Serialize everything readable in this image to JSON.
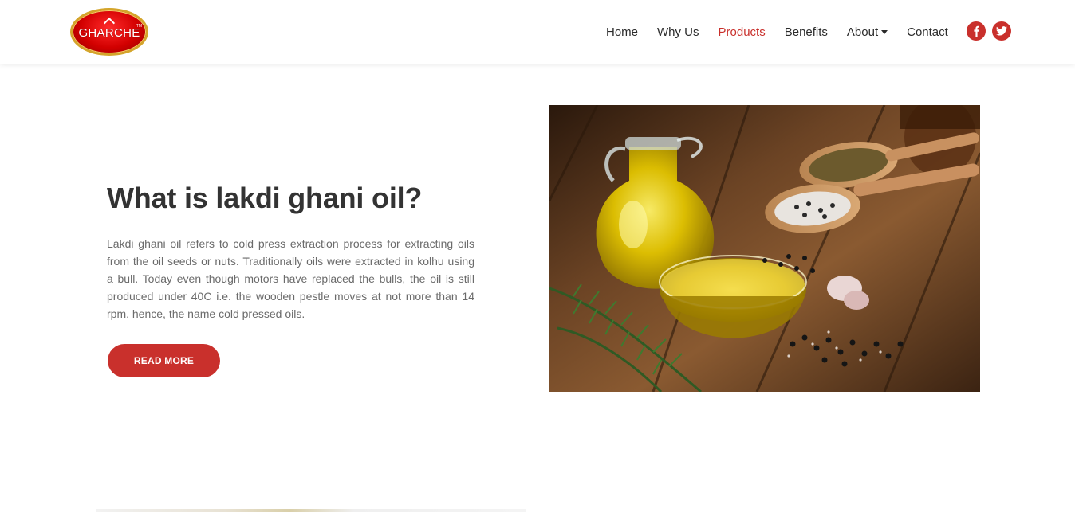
{
  "brand": {
    "logo_text": "GHARCHE",
    "logo_tm": "TM",
    "logo_colors": {
      "fill": "#d20000",
      "rim": "#d4a52b"
    }
  },
  "nav": {
    "items": [
      {
        "label": "Home"
      },
      {
        "label": "Why Us"
      },
      {
        "label": "Products"
      },
      {
        "label": "Benefits"
      },
      {
        "label": "About"
      },
      {
        "label": "Contact"
      }
    ],
    "active": "Products",
    "about_has_dropdown": true
  },
  "social": [
    {
      "icon": "facebook-icon"
    },
    {
      "icon": "twitter-icon"
    }
  ],
  "hero": {
    "title": "What is lakdi ghani oil?",
    "body": "Lakdi ghani oil refers to cold press extraction process for extracting oils from the oil seeds or nuts. Traditionally oils were extracted in kolhu using a bull. Today even though motors have replaced the bulls, the oil is still produced under 40C i.e. the wooden pestle moves at not more than 14 rpm. hence, the name cold pressed oils.",
    "button_label": "READ MORE",
    "image_icon": "olive-oil-photo"
  },
  "colors": {
    "accent": "#c9302c",
    "text_dark": "#333333",
    "text_body": "#6b6b6b",
    "nav_text": "#2b2b2b"
  }
}
